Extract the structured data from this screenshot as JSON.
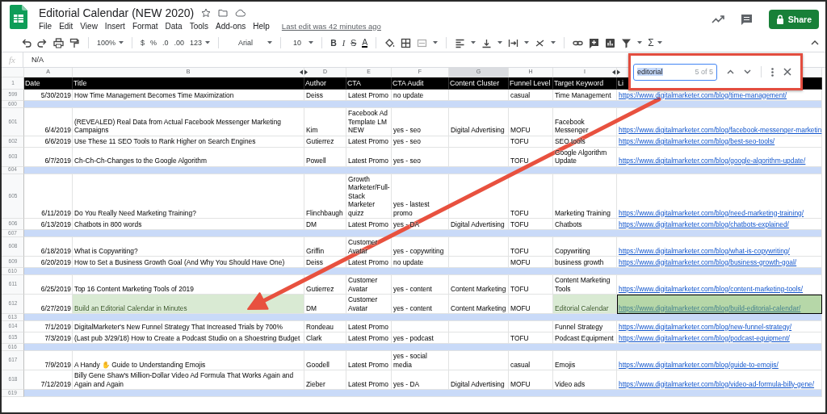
{
  "header": {
    "title": "Editorial Calendar (NEW 2020)",
    "menu": [
      "File",
      "Edit",
      "View",
      "Insert",
      "Format",
      "Data",
      "Tools",
      "Add-ons",
      "Help"
    ],
    "last_edit": "Last edit was 42 minutes ago",
    "share": "Share"
  },
  "toolbar": {
    "zoom": "100%",
    "currency": "$",
    "percent": "%",
    "decimal_less": ".0",
    "decimal_more": ".00",
    "number_format": "123",
    "font": "Arial",
    "font_size": "10",
    "bold": "B",
    "italic": "I",
    "strike": "S",
    "text_color": "A",
    "functions": "Σ"
  },
  "formula_bar": {
    "label": "fx",
    "value": "N/A"
  },
  "columns": [
    {
      "letter": "A",
      "shaded": false,
      "hidden_after": false
    },
    {
      "letter": "B",
      "shaded": false,
      "hidden_after": true
    },
    {
      "letter": "D",
      "shaded": false,
      "hidden_after": false
    },
    {
      "letter": "E",
      "shaded": false,
      "hidden_after": false
    },
    {
      "letter": "F",
      "shaded": false,
      "hidden_after": false
    },
    {
      "letter": "G",
      "shaded": true,
      "hidden_after": false
    },
    {
      "letter": "H",
      "shaded": false,
      "hidden_after": false
    },
    {
      "letter": "I",
      "shaded": false,
      "hidden_after": true
    }
  ],
  "header_row": {
    "num": "1",
    "cells": [
      "Date",
      "Title",
      "Author",
      "CTA",
      "CTA Audit",
      "Content Cluster",
      "Funnel Level",
      "Target Keyword",
      "Li"
    ]
  },
  "rows": [
    {
      "num": "599",
      "kind": "data",
      "found": false,
      "selected": false,
      "date": "5/30/2019",
      "title": "How Time Management Becomes Time Maximization",
      "author": "Deiss",
      "cta": "Latest Promo",
      "cta_audit": "no update",
      "funnel": "casual",
      "keyword": "Time Management",
      "link": "https://www.digitalmarketer.com/blog/time-management/"
    },
    {
      "num": "600",
      "kind": "blank",
      "found": false,
      "selected": false
    },
    {
      "num": "601",
      "kind": "data",
      "found": false,
      "selected": false,
      "date": "6/4/2019",
      "title": "(REVEALED) Real Data from Actual Facebook Messenger Marketing Campaigns",
      "author": "Kim",
      "cta": "Facebook Ad Template LM NEW",
      "cta_audit": "yes - seo",
      "cluster": "Digital Advertising",
      "funnel": "MOFU",
      "keyword": "Facebook Messenger",
      "link": "https://www.digitalmarketer.com/blog/facebook-messenger-marketin"
    },
    {
      "num": "602",
      "kind": "data",
      "found": false,
      "selected": false,
      "date": "6/6/2019",
      "title": "Use These 11 SEO Tools to Rank Higher on Search Engines",
      "author": "Gutierrez",
      "cta": "Latest Promo",
      "cta_audit": "yes - seo",
      "funnel": "TOFU",
      "keyword": "SEO tools",
      "link": "https://www.digitalmarketer.com/blog/best-seo-tools/"
    },
    {
      "num": "603",
      "kind": "data",
      "found": false,
      "selected": false,
      "date": "6/7/2019",
      "title": "Ch-Ch-Ch-Changes to the Google Algorithm",
      "author": "Powell",
      "cta": "Latest Promo",
      "cta_audit": "yes - seo",
      "funnel": "TOFU",
      "keyword": "Google Algorithm Update",
      "link": "https://www.digitalmarketer.com/blog/google-algorithm-update/"
    },
    {
      "num": "604",
      "kind": "blank",
      "found": false,
      "selected": false
    },
    {
      "num": "605",
      "kind": "data",
      "found": false,
      "selected": false,
      "date": "6/11/2019",
      "title": "Do You Really Need Marketing Training?",
      "author": "Flinchbaugh",
      "cta": "Growth Marketer/Full-Stack Marketer quizz",
      "cta_audit": "yes - lastest promo",
      "funnel": "TOFU",
      "keyword": "Marketing Training",
      "link": "https://www.digitalmarketer.com/blog/need-marketing-training/"
    },
    {
      "num": "606",
      "kind": "data",
      "found": false,
      "selected": false,
      "date": "6/13/2019",
      "title": "Chatbots in 800 words",
      "author": "DM",
      "cta": "Latest Promo",
      "cta_audit": "yes - DA",
      "cluster": "Digital Advertising",
      "funnel": "TOFU",
      "keyword": "Chatbots",
      "link": "https://www.digitalmarketer.com/blog/chatbots-explained/"
    },
    {
      "num": "607",
      "kind": "blank",
      "found": false,
      "selected": false
    },
    {
      "num": "608",
      "kind": "data",
      "found": false,
      "selected": false,
      "date": "6/18/2019",
      "title": "What is Copywriting?",
      "author": "Griffin",
      "cta": "Customer Avatar",
      "cta_audit": "yes - copywriting",
      "funnel": "TOFU",
      "keyword": "Copywriting",
      "link": "https://www.digitalmarketer.com/blog/what-is-copywriting/"
    },
    {
      "num": "609",
      "kind": "data",
      "found": false,
      "selected": false,
      "date": "6/20/2019",
      "title": "How to Set a Business Growth Goal (And Why You Should Have One)",
      "author": "Deiss",
      "cta": "Latest Promo",
      "cta_audit": "no update",
      "funnel": "MOFU",
      "keyword": "business growth",
      "link": "https://www.digitalmarketer.com/blog/business-growth-goal/"
    },
    {
      "num": "610",
      "kind": "blank",
      "found": false,
      "selected": false
    },
    {
      "num": "611",
      "kind": "data",
      "found": false,
      "selected": false,
      "date": "6/25/2019",
      "title": "Top 16 Content Marketing Tools of 2019",
      "author": "Gutierrez",
      "cta": "Customer Avatar",
      "cta_audit": "yes - content",
      "cluster": "Content Marketing",
      "funnel": "TOFU",
      "keyword": "Content Marketing Tools",
      "link": "https://www.digitalmarketer.com/blog/content-marketing-tools/"
    },
    {
      "num": "612",
      "kind": "data",
      "found": true,
      "selected": true,
      "date": "6/27/2019",
      "title": "Build an Editorial Calendar in Minutes",
      "author": "DM",
      "cta": "Customer Avatar",
      "cta_audit": "yes - content",
      "cluster": "Content Marketing",
      "funnel": "MOFU",
      "keyword": "Editorial Calendar",
      "link": "https://www.digitalmarketer.com/blog/build-editorial-calendar/"
    },
    {
      "num": "613",
      "kind": "blank",
      "found": false,
      "selected": false
    },
    {
      "num": "614",
      "kind": "data",
      "found": false,
      "selected": false,
      "date": "7/1/2019",
      "title": "DigitalMarketer's New Funnel Strategy That Increased Trials by 700%",
      "author": "Rondeau",
      "cta": "Latest Promo",
      "keyword": "Funnel Strategy",
      "link": "https://www.digitalmarketer.com/blog/new-funnel-strategy/"
    },
    {
      "num": "615",
      "kind": "data",
      "found": false,
      "selected": false,
      "date": "7/3/2019",
      "title": "(Last pub 3/29/18) How to Create a Podcast Studio on a Shoestring Budget",
      "author": "Clark",
      "cta": "Latest Promo",
      "cta_audit": "yes - podcast",
      "funnel": "TOFU",
      "keyword": "Podcast Equipment",
      "link": "https://www.digitalmarketer.com/blog/podcast-equipment/"
    },
    {
      "num": "616",
      "kind": "blank",
      "found": false,
      "selected": false
    },
    {
      "num": "617",
      "kind": "data",
      "found": false,
      "selected": false,
      "date": "7/9/2019",
      "title": "A Handy ✋ Guide to Understanding Emojis",
      "author": "Goodell",
      "cta": "Latest Promo",
      "cta_audit": "yes - social media",
      "funnel": "casual",
      "keyword": "Emojis",
      "link": "https://www.digitalmarketer.com/blog/guide-to-emojis/"
    },
    {
      "num": "618",
      "kind": "data",
      "found": false,
      "selected": false,
      "date": "7/12/2019",
      "title": "Billy Gene Shaw's Million-Dollar Video Ad Formula That Works Again and Again and Again",
      "author": "Zieber",
      "cta": "Latest Promo",
      "cta_audit": "yes - DA",
      "cluster": "Digital Advertising",
      "funnel": "MOFU",
      "keyword": "Video ads",
      "link": "https://www.digitalmarketer.com/blog/video-ad-formula-billy-gene/"
    },
    {
      "num": "619",
      "kind": "blank",
      "found": false,
      "selected": false
    }
  ],
  "find_bar": {
    "query": "editorial",
    "query_selected": true,
    "count": "5 of 5"
  }
}
